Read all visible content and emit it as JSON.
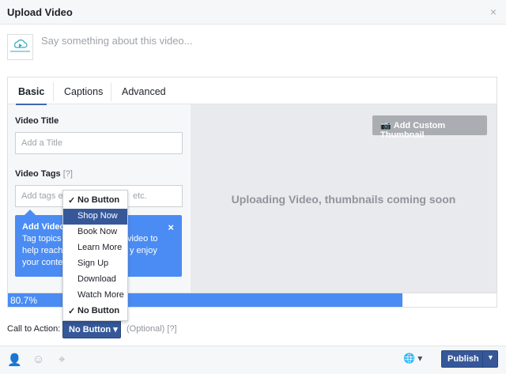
{
  "dialog": {
    "title": "Upload Video",
    "close_icon": "×"
  },
  "composer": {
    "placeholder": "Say something about this video...",
    "avatar_logo": "OnlineVideo"
  },
  "tabs": [
    {
      "label": "Basic",
      "active": true
    },
    {
      "label": "Captions"
    },
    {
      "label": "Advanced"
    }
  ],
  "basic": {
    "title_label": "Video Title",
    "title_placeholder": "Add a Title",
    "tags_label": "Video Tags",
    "tags_help": "[?]",
    "tags_placeholder": "Add tags ex",
    "tags_placeholder_tail": "etc.",
    "tip": {
      "title": "Add Video",
      "line1": "Tag topics a",
      "line1_tail": "video to",
      "line2": "help reach a",
      "line2_tail": "y enjoy",
      "line3": "your conten",
      "close": "×"
    }
  },
  "preview": {
    "thumbnail_button": "Add Custom Thumbnail",
    "message": "Uploading Video, thumbnails coming soon"
  },
  "progress": {
    "percent": 80.7,
    "label": "80.7%"
  },
  "cta": {
    "label": "Call to Action:",
    "value": "No Button",
    "optional": "(Optional) [?]",
    "menu": [
      {
        "label": "No Button",
        "checked": true
      },
      {
        "label": "Shop Now",
        "highlighted": true
      },
      {
        "label": "Book Now"
      },
      {
        "label": "Learn More"
      },
      {
        "label": "Sign Up"
      },
      {
        "label": "Download"
      },
      {
        "label": "Watch More"
      },
      {
        "label": "No Button",
        "checked": true
      }
    ]
  },
  "footer": {
    "publish": "Publish",
    "icons": [
      "tag-person-icon",
      "emoji-icon",
      "location-icon",
      "globe-icon"
    ]
  },
  "colors": {
    "accent": "#365899",
    "tip": "#4a8cf3",
    "progress": "#4a8cf3"
  }
}
